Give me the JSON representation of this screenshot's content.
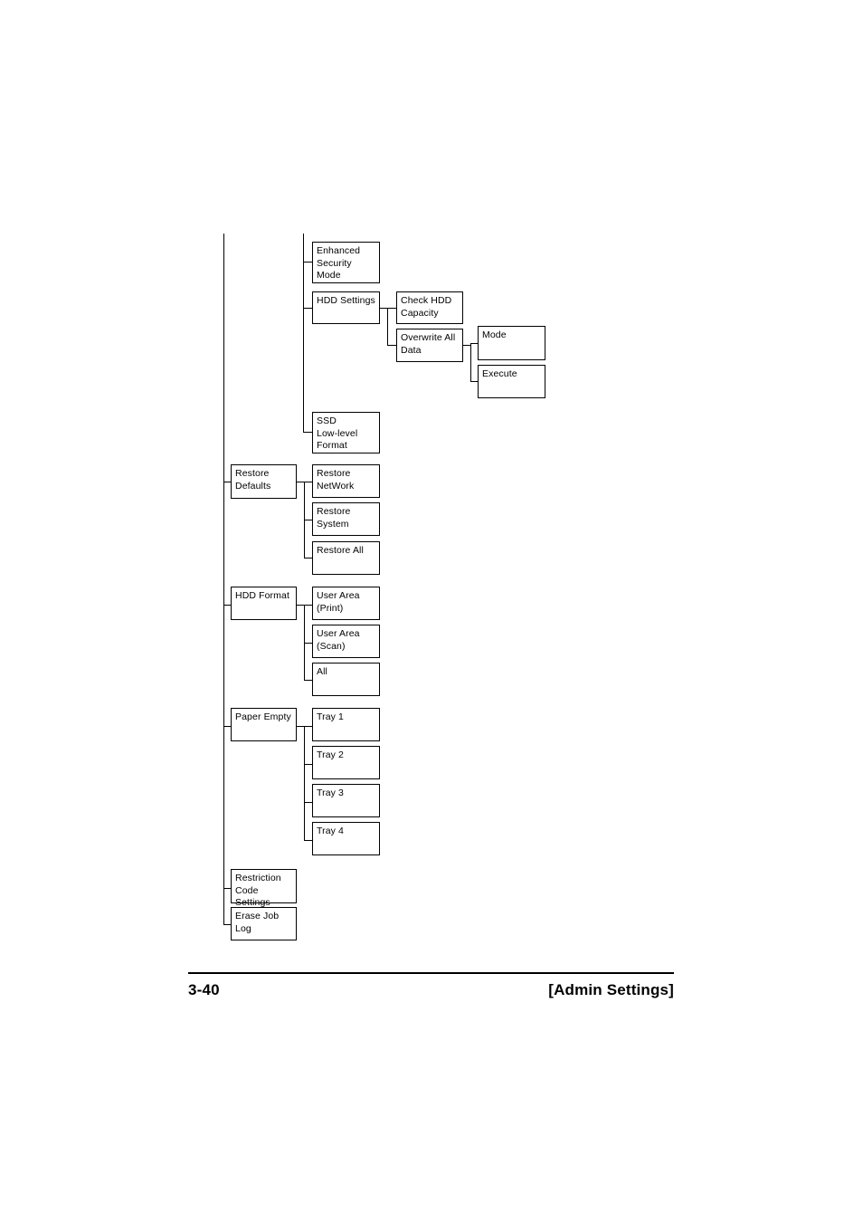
{
  "page": {
    "footer_page_number": "3-40",
    "footer_section_title": "[Admin Settings]"
  },
  "diagram": {
    "type": "menu-tree",
    "description": "Printer Admin Settings menu hierarchy continued",
    "columns": 4,
    "nodes": {
      "enhanced_security_mode": "Enhanced\nSecurity\nMode",
      "hdd_settings": "HDD Settings",
      "check_hdd_capacity": "Check HDD\nCapacity",
      "overwrite_all_data": "Overwrite All\nData",
      "mode": "Mode",
      "execute": "Execute",
      "ssd_low_level_format": "SSD\nLow-level\nFormat",
      "restore_defaults": "Restore\nDefaults",
      "restore_network": "Restore\nNetWork",
      "restore_system": "Restore\nSystem",
      "restore_all": "Restore All",
      "hdd_format": "HDD Format",
      "user_area_print": "User Area\n(Print)",
      "user_area_scan": "User Area\n(Scan)",
      "all": "All",
      "paper_empty": "Paper Empty",
      "tray_1": "Tray 1",
      "tray_2": "Tray 2",
      "tray_3": "Tray 3",
      "tray_4": "Tray 4",
      "restriction_code_settings": "Restriction\nCode Settings",
      "erase_job_log": "Erase Job Log"
    }
  }
}
